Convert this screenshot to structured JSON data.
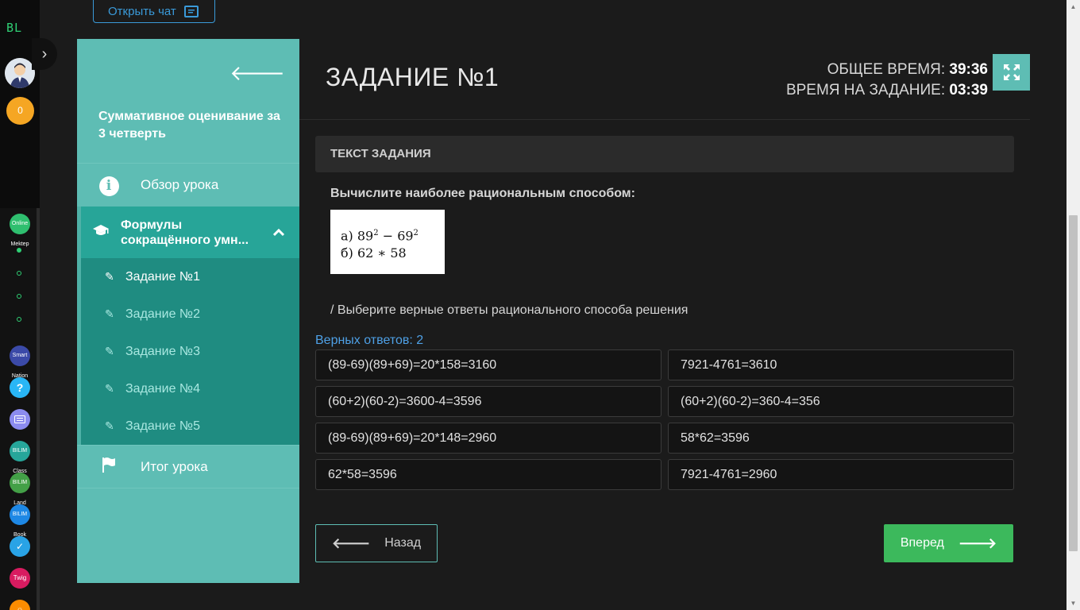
{
  "rail": {
    "logo": "BL",
    "coins": "0",
    "icons": [
      {
        "name": "onlinemektep-icon",
        "label": "Online Mektep",
        "color": "#2fbf6f"
      },
      {
        "name": "smart-nation-icon",
        "label": "Smart Nation",
        "color": "#3b4aa8"
      },
      {
        "name": "help-icon",
        "label": "?",
        "color": "#29b6f6"
      },
      {
        "name": "keyboard-icon",
        "label": "",
        "color": "#8c8cf0"
      },
      {
        "name": "bilimclass-icon",
        "label": "BILIM Class",
        "color": "#26a69a"
      },
      {
        "name": "bilimland-icon",
        "label": "BILIM Land",
        "color": "#43a047"
      },
      {
        "name": "bilimbook-icon",
        "label": "BILIM Book",
        "color": "#1e88e5"
      },
      {
        "name": "check-app-icon",
        "label": "",
        "color": "#29a3e6"
      },
      {
        "name": "twig-icon",
        "label": "Twig",
        "color": "#d81b60"
      },
      {
        "name": "sun-app-icon",
        "label": "",
        "color": "#fb8c00"
      }
    ]
  },
  "chat_button": {
    "label": "Открыть чат"
  },
  "sidebar": {
    "title": "Суммативное оценивание за 3 четверть",
    "overview": "Обзор урока",
    "section": "Формулы сокращённого умн...",
    "tasks": [
      "Задание №1",
      "Задание №2",
      "Задание №3",
      "Задание №4",
      "Задание №5"
    ],
    "summary": "Итог урока"
  },
  "main": {
    "title": "ЗАДАНИЕ №1",
    "timer": {
      "total_label": "ОБЩЕЕ ВРЕМЯ:",
      "total_value": "39:36",
      "task_label": "ВРЕМЯ НА ЗАДАНИЕ:",
      "task_value": "03:39"
    },
    "task_header": "ТЕКСТ ЗАДАНИЯ",
    "question": "Вычислите наиболее рациональным способом:",
    "formula": {
      "line1_prefix": "а) 89",
      "line1_exp": "2",
      "line1_mid": " − 69",
      "line1_exp2": "2",
      "line2": "б) 62 ∗ 58"
    },
    "instruction": "/ Выберите верные ответы рационального способа решения",
    "correct_count": "Верных ответов: 2",
    "answers": [
      "(89-69)(89+69)=20*158=3160",
      "7921-4761=3610",
      "(60+2)(60-2)=3600-4=3596",
      "(60+2)(60-2)=360-4=356",
      "(89-69)(89+69)=20*148=2960",
      "58*62=3596",
      "62*58=3596",
      "7921-4761=2960"
    ],
    "back_label": "Назад",
    "next_label": "Вперед"
  },
  "colors": {
    "teal": "#5ebdb4",
    "teal_dark": "#1f8c81",
    "green": "#3cb95c",
    "link_blue": "#4ea0e6"
  }
}
